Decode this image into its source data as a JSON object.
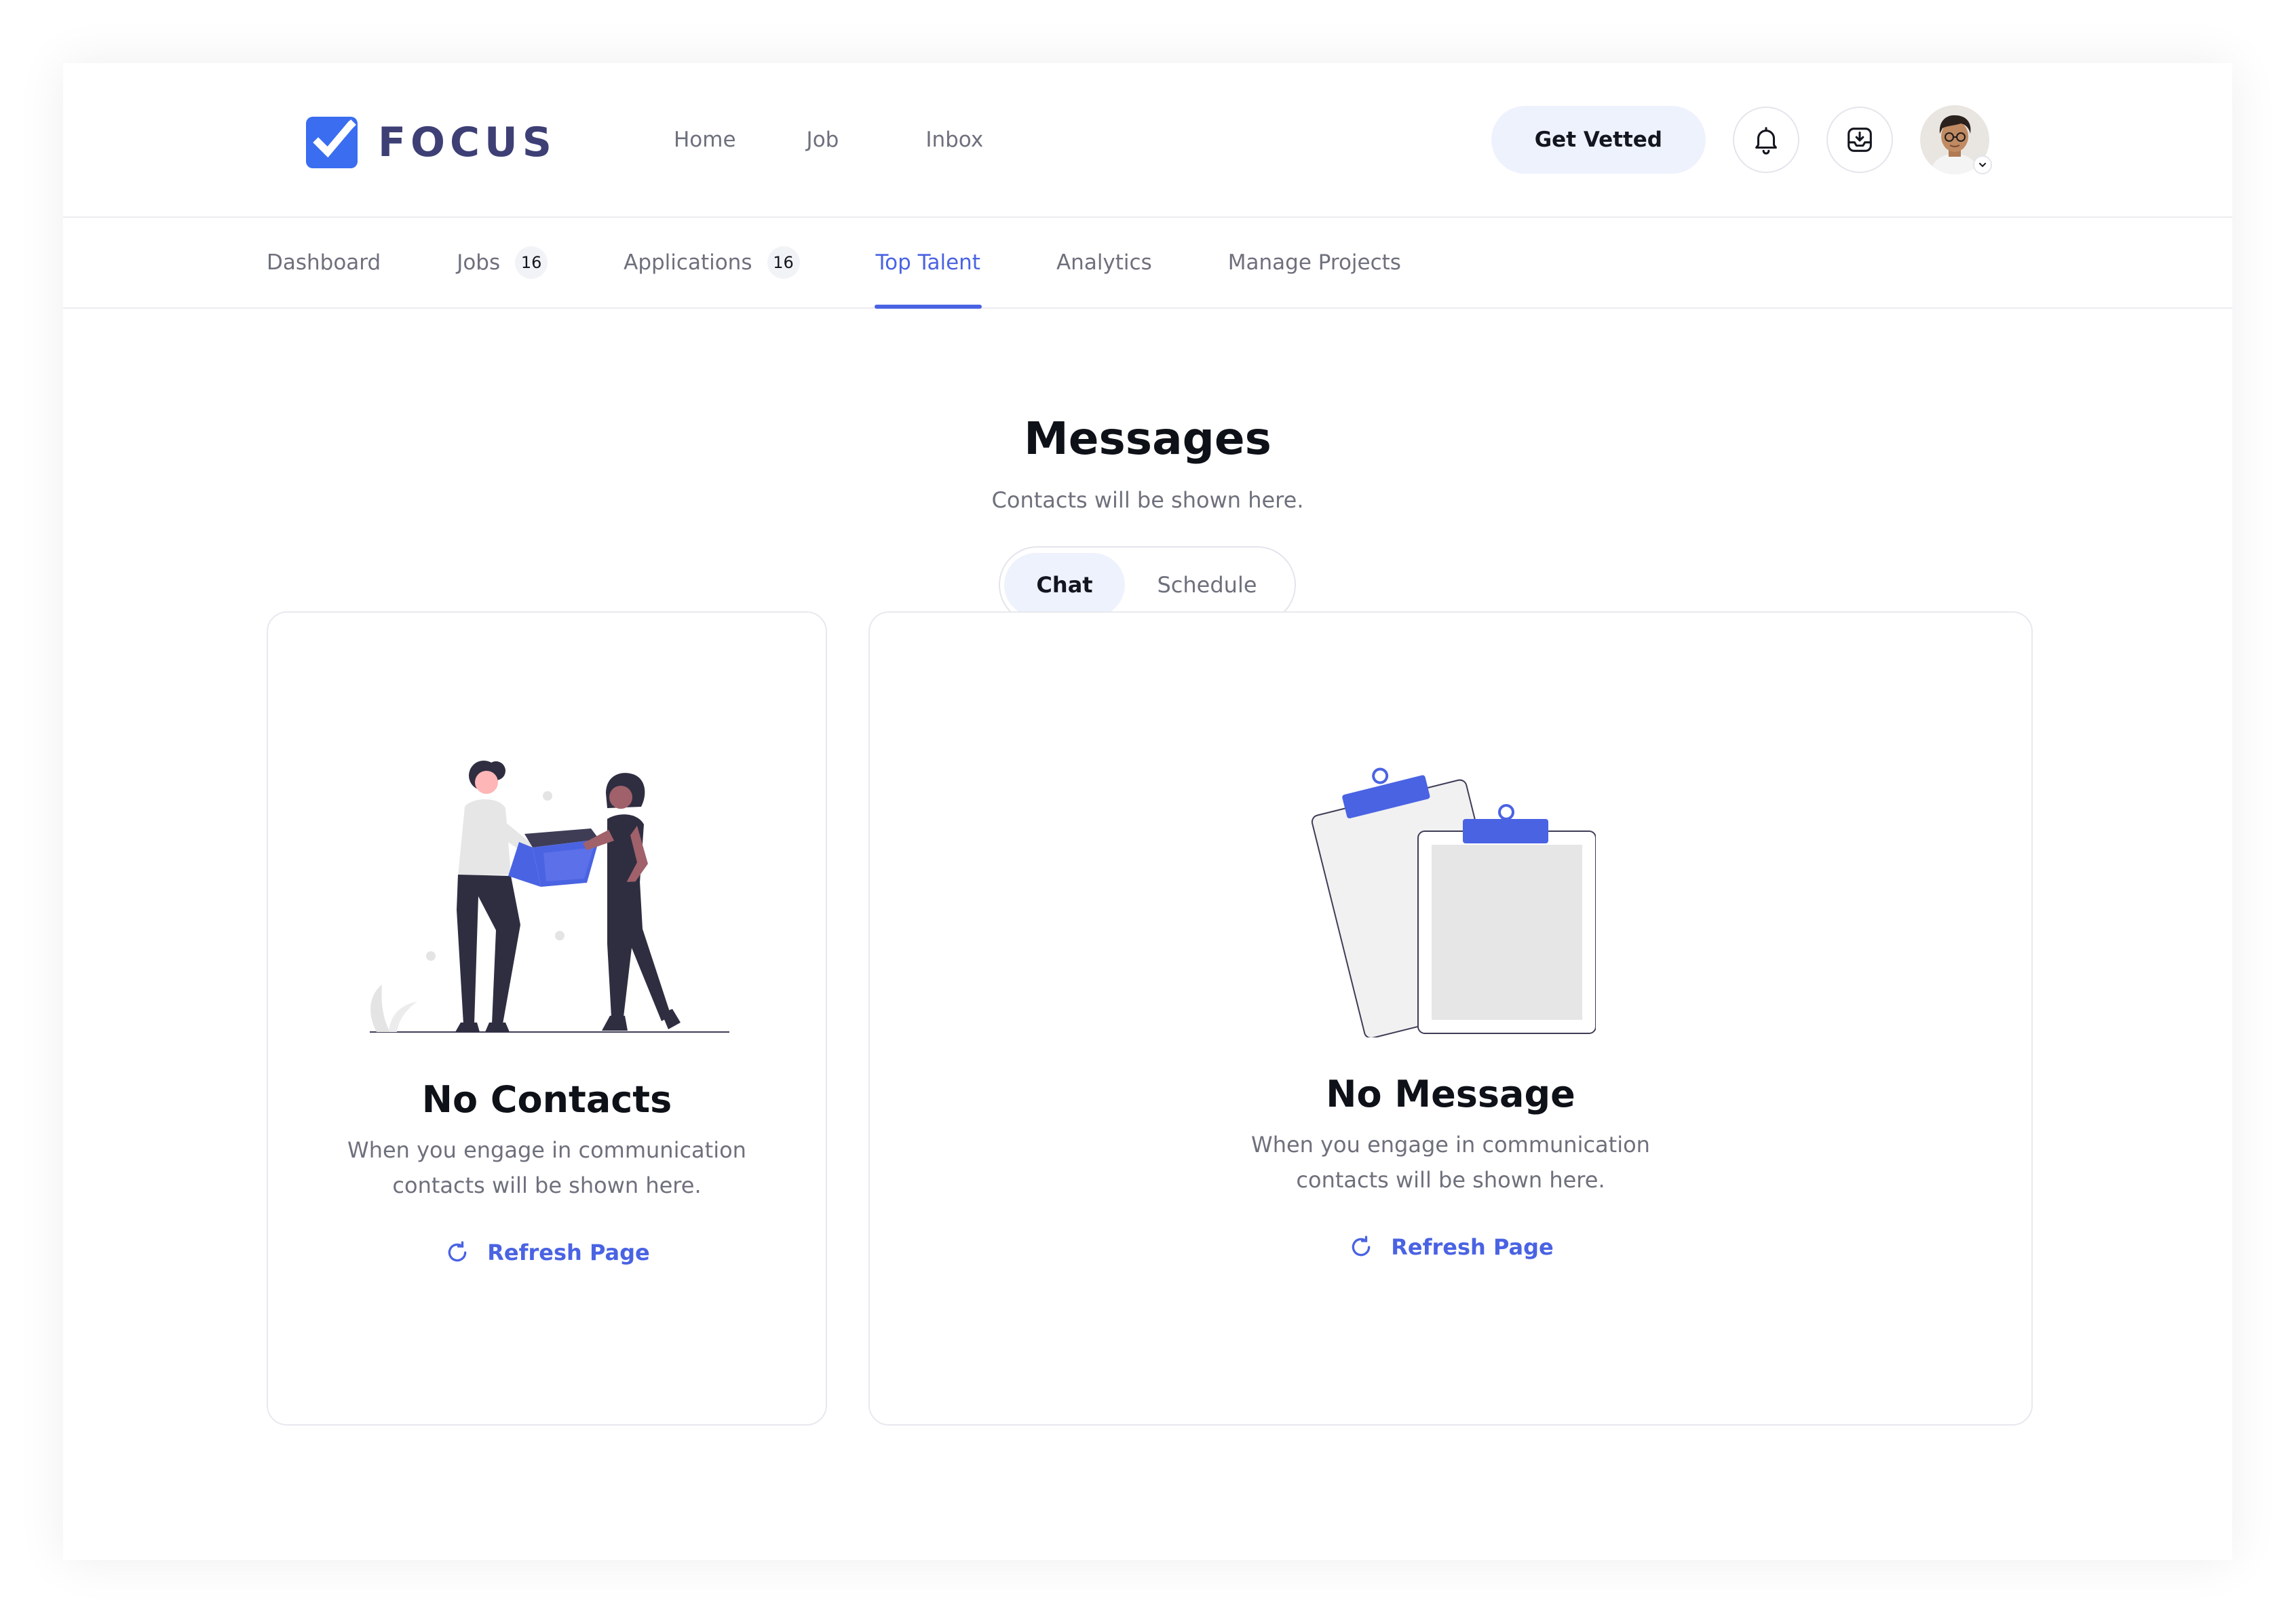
{
  "brand": {
    "name": "FOCUS",
    "accent": "#4a63e3",
    "logo_color": "#3d3f75"
  },
  "topnav": {
    "items": [
      {
        "label": "Home"
      },
      {
        "label": "Job"
      },
      {
        "label": "Inbox"
      }
    ]
  },
  "actions": {
    "cta_label": "Get Vetted",
    "notification_icon": "bell-icon",
    "download_icon": "inbox-download-icon",
    "avatar_icon": "user-avatar"
  },
  "tabs": [
    {
      "label": "Dashboard"
    },
    {
      "label": "Jobs",
      "count": "16"
    },
    {
      "label": "Applications",
      "count": "16"
    },
    {
      "label": "Top Talent",
      "active": true
    },
    {
      "label": "Analytics"
    },
    {
      "label": "Manage Projects"
    }
  ],
  "page": {
    "title": "Messages",
    "subtitle": "Contacts will be shown here.",
    "toggle": {
      "options": [
        "Chat",
        "Schedule"
      ],
      "selected": "Chat"
    }
  },
  "contacts_panel": {
    "title": "No Contacts",
    "description_line1": "When you engage in communication",
    "description_line2": "contacts will be shown here.",
    "action_label": "Refresh Page",
    "illustration": "people-handing-box-illustration"
  },
  "messages_panel": {
    "title": "No Message",
    "description_line1": "When you engage in communication",
    "description_line2": "contacts will be shown here.",
    "action_label": "Refresh Page",
    "illustration": "empty-clipboards-illustration"
  }
}
